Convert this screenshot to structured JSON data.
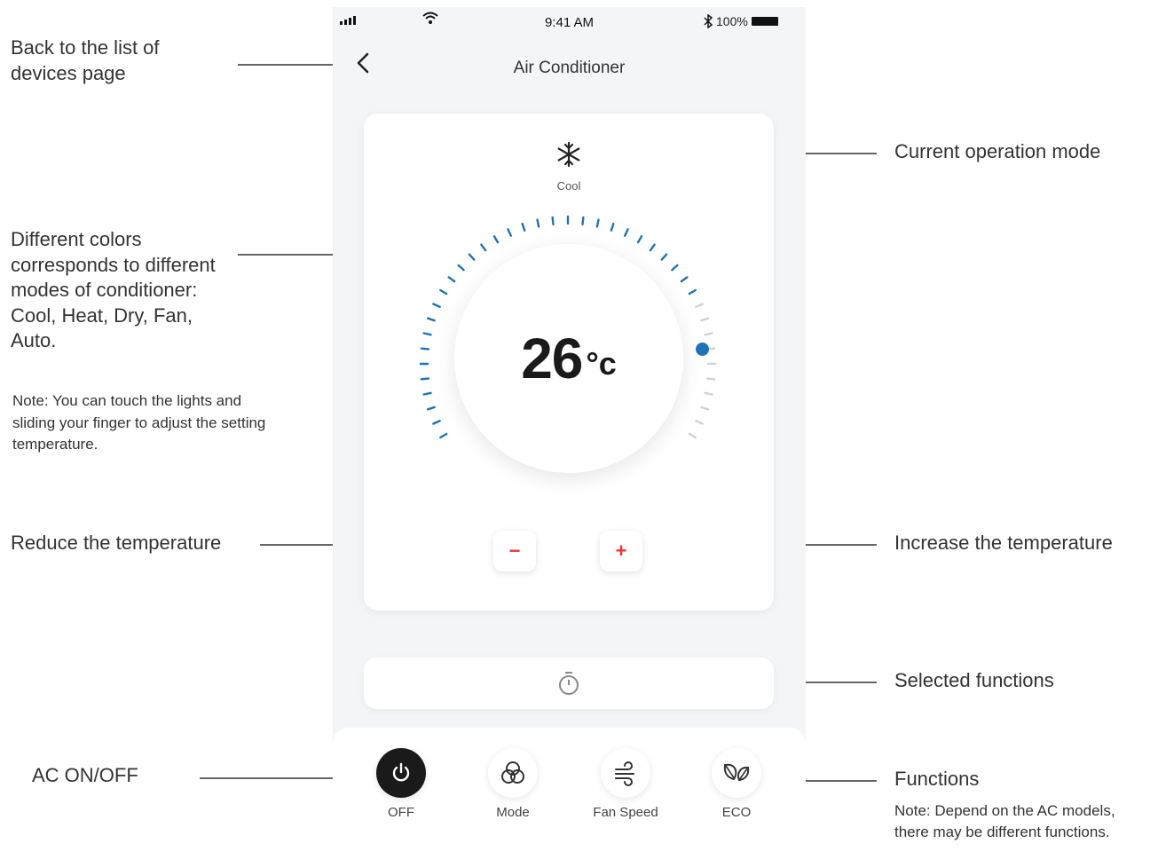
{
  "status_bar": {
    "time": "9:41 AM",
    "battery": "100%"
  },
  "header": {
    "title": "Air Conditioner"
  },
  "mode": {
    "label": "Cool"
  },
  "temperature": {
    "value": "26",
    "unit": "°c",
    "colors": {
      "cool": "#1e73b8",
      "inactive": "#cfd3d8"
    }
  },
  "controls": {
    "minus": "−",
    "plus": "+"
  },
  "functions": [
    {
      "label": "OFF"
    },
    {
      "label": "Mode"
    },
    {
      "label": "Fan Speed"
    },
    {
      "label": "ECO"
    }
  ],
  "annotations": {
    "back": "Back to the list of devices page",
    "current_mode": "Current operation mode",
    "colors": "Different colors corresponds to different modes of conditioner: Cool, Heat, Dry, Fan, Auto.",
    "colors_note": "Note: You can touch the lights and sliding your finger to adjust the setting temperature.",
    "reduce": "Reduce the temperature",
    "increase": "Increase the temperature",
    "selected": "Selected functions",
    "onoff": "AC ON/OFF",
    "functions": "Functions",
    "functions_note": "Note: Depend on the AC models, there may be different functions."
  }
}
